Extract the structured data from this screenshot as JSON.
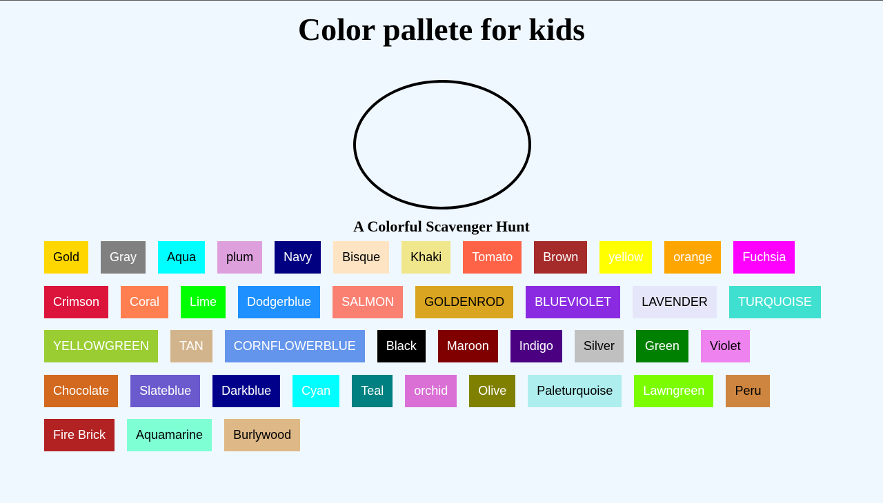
{
  "page": {
    "title": "Color pallete for kids",
    "subtitle": "A Colorful Scavenger Hunt"
  },
  "colors": [
    {
      "label": "Gold",
      "bg": "#ffd700",
      "fg": "#000000"
    },
    {
      "label": "Gray",
      "bg": "#808080",
      "fg": "#ffffff"
    },
    {
      "label": "Aqua",
      "bg": "#00ffff",
      "fg": "#000000"
    },
    {
      "label": "plum",
      "bg": "#dda0dd",
      "fg": "#000000"
    },
    {
      "label": "Navy",
      "bg": "#000080",
      "fg": "#ffffff"
    },
    {
      "label": "Bisque",
      "bg": "#ffe4c4",
      "fg": "#000000"
    },
    {
      "label": "Khaki",
      "bg": "#f0e68c",
      "fg": "#000000"
    },
    {
      "label": "Tomato",
      "bg": "#ff6347",
      "fg": "#ffffff"
    },
    {
      "label": "Brown",
      "bg": "#a52a2a",
      "fg": "#ffffff"
    },
    {
      "label": "yellow",
      "bg": "#ffff00",
      "fg": "#ffffff"
    },
    {
      "label": "orange",
      "bg": "#ffa500",
      "fg": "#ffffff"
    },
    {
      "label": "Fuchsia",
      "bg": "#ff00ff",
      "fg": "#ffffff"
    },
    {
      "label": "Crimson",
      "bg": "#dc143c",
      "fg": "#ffffff"
    },
    {
      "label": "Coral",
      "bg": "#ff7f50",
      "fg": "#ffffff"
    },
    {
      "label": "Lime",
      "bg": "#00ff00",
      "fg": "#ffffff"
    },
    {
      "label": "Dodgerblue",
      "bg": "#1e90ff",
      "fg": "#ffffff"
    },
    {
      "label": "SALMON",
      "bg": "#fa8072",
      "fg": "#ffffff"
    },
    {
      "label": "GOLDENROD",
      "bg": "#daa520",
      "fg": "#000000"
    },
    {
      "label": "BLUEVIOLET",
      "bg": "#8a2be2",
      "fg": "#ffffff"
    },
    {
      "label": "LAVENDER",
      "bg": "#e6e6fa",
      "fg": "#000000"
    },
    {
      "label": "TURQUOISE",
      "bg": "#40e0d0",
      "fg": "#ffffff"
    },
    {
      "label": "YELLOWGREEN",
      "bg": "#9acd32",
      "fg": "#ffffff"
    },
    {
      "label": "TAN",
      "bg": "#d2b48c",
      "fg": "#ffffff"
    },
    {
      "label": "CORNFLOWERBLUE",
      "bg": "#6495ed",
      "fg": "#ffffff"
    },
    {
      "label": "Black",
      "bg": "#000000",
      "fg": "#ffffff"
    },
    {
      "label": "Maroon",
      "bg": "#800000",
      "fg": "#ffffff"
    },
    {
      "label": "Indigo",
      "bg": "#4b0082",
      "fg": "#ffffff"
    },
    {
      "label": "Silver",
      "bg": "#c0c0c0",
      "fg": "#000000"
    },
    {
      "label": "Green",
      "bg": "#008000",
      "fg": "#ffffff"
    },
    {
      "label": "Violet",
      "bg": "#ee82ee",
      "fg": "#000000"
    },
    {
      "label": "Chocolate",
      "bg": "#d2691e",
      "fg": "#ffffff"
    },
    {
      "label": "Slateblue",
      "bg": "#6a5acd",
      "fg": "#ffffff"
    },
    {
      "label": "Darkblue",
      "bg": "#00008b",
      "fg": "#ffffff"
    },
    {
      "label": "Cyan",
      "bg": "#00ffff",
      "fg": "#ffffff"
    },
    {
      "label": "Teal",
      "bg": "#008080",
      "fg": "#ffffff"
    },
    {
      "label": "orchid",
      "bg": "#da70d6",
      "fg": "#ffffff"
    },
    {
      "label": "Olive",
      "bg": "#808000",
      "fg": "#ffffff"
    },
    {
      "label": "Paleturquoise",
      "bg": "#afeeee",
      "fg": "#000000"
    },
    {
      "label": "Lawngreen",
      "bg": "#7cfc00",
      "fg": "#ffffff"
    },
    {
      "label": "Peru",
      "bg": "#cd853f",
      "fg": "#000000"
    },
    {
      "label": "Fire Brick",
      "bg": "#b22222",
      "fg": "#ffffff"
    },
    {
      "label": "Aquamarine",
      "bg": "#7fffd4",
      "fg": "#000000"
    },
    {
      "label": "Burlywood",
      "bg": "#deb887",
      "fg": "#000000"
    }
  ],
  "theme": {
    "background": "#f0f8ff",
    "circle_border": "#000000"
  }
}
